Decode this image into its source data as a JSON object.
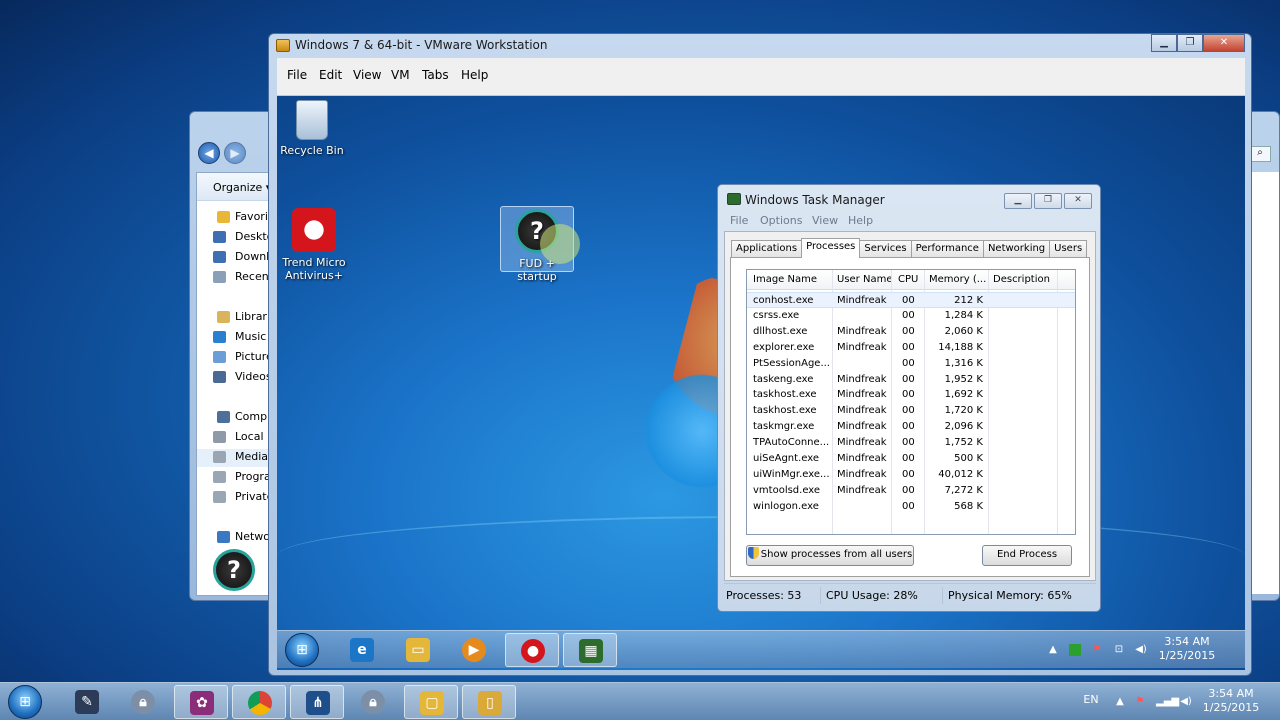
{
  "host": {
    "explorer": {
      "toolbar_label": "Organize ▾",
      "nav_items": [
        {
          "label": "Favorites",
          "icon": "star-icon",
          "header": true
        },
        {
          "label": "Desktop",
          "icon": "desktop-icon"
        },
        {
          "label": "Downloads",
          "icon": "downloads-icon"
        },
        {
          "label": "Recent Places",
          "icon": "recent-places-icon"
        },
        {
          "label": "Libraries",
          "icon": "libraries-icon",
          "header": true
        },
        {
          "label": "Music",
          "icon": "music-icon"
        },
        {
          "label": "Pictures",
          "icon": "pictures-icon"
        },
        {
          "label": "Videos",
          "icon": "videos-icon"
        },
        {
          "label": "Computer",
          "icon": "computer-icon",
          "header": true
        },
        {
          "label": "Local Disk",
          "icon": "local-disk-icon"
        },
        {
          "label": "Media",
          "icon": "drive-icon"
        },
        {
          "label": "Programs",
          "icon": "drive-icon"
        },
        {
          "label": "Private",
          "icon": "drive-icon"
        },
        {
          "label": "Network",
          "icon": "network-icon",
          "header": true
        }
      ]
    },
    "taskbar": {
      "language": "EN",
      "time": "3:54 AM",
      "date": "1/25/2015",
      "buttons": [
        "start-orb",
        "pen-app",
        "lock-app",
        "media-app",
        "chrome",
        "vmware",
        "lock-app-2",
        "explorer",
        "folder"
      ]
    }
  },
  "vmware": {
    "title": "Windows 7 & 64-bit - VMware Workstation",
    "minimize": "▁",
    "restore": "❐",
    "close": "✕",
    "menu": [
      "File",
      "Edit",
      "View",
      "VM",
      "Tabs",
      "Help"
    ]
  },
  "guest": {
    "desktop_icons": {
      "recycle_bin": "Recycle Bin",
      "trend_micro": "Trend Micro Antivirus+",
      "fud_startup": "FUD + startup"
    },
    "taskbar": {
      "time": "3:54 AM",
      "date": "1/25/2015"
    }
  },
  "taskmgr": {
    "title": "Windows Task Manager",
    "menu": [
      "File",
      "Options",
      "View",
      "Help"
    ],
    "tabs": [
      "Applications",
      "Processes",
      "Services",
      "Performance",
      "Networking",
      "Users"
    ],
    "active_tab": "Processes",
    "columns": [
      "Image Name",
      "User Name",
      "CPU",
      "Memory (...",
      "Description"
    ],
    "rows": [
      {
        "name": "conhost.exe",
        "user": "Mindfreak",
        "cpu": "00",
        "mem": "212 K"
      },
      {
        "name": "csrss.exe",
        "user": "",
        "cpu": "00",
        "mem": "1,284 K"
      },
      {
        "name": "dllhost.exe",
        "user": "Mindfreak",
        "cpu": "00",
        "mem": "2,060 K"
      },
      {
        "name": "explorer.exe",
        "user": "Mindfreak",
        "cpu": "00",
        "mem": "14,188 K"
      },
      {
        "name": "PtSessionAge...",
        "user": "",
        "cpu": "00",
        "mem": "1,316 K"
      },
      {
        "name": "taskeng.exe",
        "user": "Mindfreak",
        "cpu": "00",
        "mem": "1,952 K"
      },
      {
        "name": "taskhost.exe",
        "user": "Mindfreak",
        "cpu": "00",
        "mem": "1,692 K"
      },
      {
        "name": "taskhost.exe",
        "user": "Mindfreak",
        "cpu": "00",
        "mem": "1,720 K"
      },
      {
        "name": "taskmgr.exe",
        "user": "Mindfreak",
        "cpu": "00",
        "mem": "2,096 K"
      },
      {
        "name": "TPAutoConne...",
        "user": "Mindfreak",
        "cpu": "00",
        "mem": "1,752 K"
      },
      {
        "name": "uiSeAgnt.exe",
        "user": "Mindfreak",
        "cpu": "00",
        "mem": "500 K"
      },
      {
        "name": "uiWinMgr.exe...",
        "user": "Mindfreak",
        "cpu": "00",
        "mem": "40,012 K"
      },
      {
        "name": "vmtoolsd.exe",
        "user": "Mindfreak",
        "cpu": "00",
        "mem": "7,272 K"
      },
      {
        "name": "winlogon.exe",
        "user": "",
        "cpu": "00",
        "mem": "568 K"
      }
    ],
    "show_all_button": "Show processes from all users",
    "end_process_button": "End Process",
    "status": {
      "processes": "Processes: 53",
      "cpu": "CPU Usage: 28%",
      "memory": "Physical Memory: 65%"
    }
  }
}
